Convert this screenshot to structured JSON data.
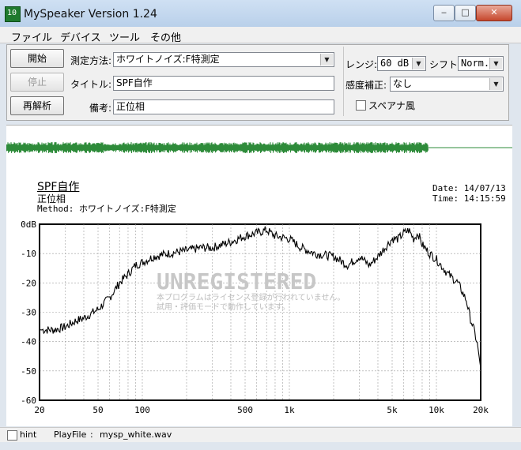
{
  "window": {
    "title": "MySpeaker Version 1.24",
    "icon_text": "10",
    "controls": {
      "minimize": "‒",
      "maximize": "□",
      "close": "✕"
    }
  },
  "menu": [
    "ファイル",
    "デバイス",
    "ツール",
    "その他"
  ],
  "buttons": {
    "start": "開始",
    "stop": "停止",
    "reanalyze": "再解析"
  },
  "fields": {
    "method_label": "測定方法:",
    "method_value": "ホワイトノイズ:F特測定",
    "title_label": "タイトル:",
    "title_value": "SPF自作",
    "note_label": "備考:",
    "note_value": "正位相",
    "range_label": "レンジ:",
    "range_value": "60 dB",
    "shift_label": "シフト:",
    "shift_value": "Norm.",
    "sens_label": "感度補正:",
    "sens_value": "なし",
    "spectrum_label": "スペアナ風"
  },
  "graph": {
    "title": "SPF自作",
    "note": "正位相",
    "method_line": "Method:  ホワイトノイズ:F特測定",
    "date": "Date: 14/07/13",
    "time": "Time: 14:15:59",
    "watermark": "UNREGISTERED",
    "watermark_sub1": "本プログラムはライセンス登録が行われていません。",
    "watermark_sub2": "試用・評価モードで動作しています。"
  },
  "chart_data": {
    "type": "line",
    "xscale": "log",
    "xlim": [
      20,
      20000
    ],
    "ylim": [
      -60,
      0
    ],
    "x_ticks": [
      "20",
      "50",
      "100",
      "500",
      "1k",
      "5k",
      "10k",
      "20k"
    ],
    "y_ticks": [
      "0dB",
      "-10",
      "-20",
      "-30",
      "-40",
      "-50",
      "-60"
    ],
    "grid": true,
    "series": [
      {
        "color": "#000000",
        "x": [
          20,
          25,
          30,
          35,
          40,
          50,
          60,
          70,
          80,
          90,
          100,
          120,
          150,
          200,
          250,
          300,
          400,
          500,
          600,
          700,
          800,
          1000,
          1200,
          1500,
          2000,
          2500,
          3000,
          3500,
          4000,
          5000,
          5500,
          6000,
          6500,
          7000,
          7500,
          8000,
          9000,
          10000,
          12000,
          14000,
          16000,
          17000,
          18000,
          19000,
          20000
        ],
        "y": [
          -36,
          -36,
          -35,
          -33,
          -32,
          -29,
          -25,
          -20,
          -17,
          -14,
          -13,
          -11,
          -10,
          -9,
          -8,
          -8,
          -6,
          -4,
          -3,
          -2,
          -4,
          -5,
          -8,
          -10,
          -11,
          -14,
          -11,
          -14,
          -11,
          -5,
          -5,
          -3,
          -2,
          -5,
          -3,
          -7,
          -10,
          -12,
          -17,
          -20,
          -26,
          -32,
          -36,
          -41,
          -49
        ]
      }
    ]
  },
  "status": {
    "hint_label": "hint",
    "playfile_label": "PlayFile",
    "playfile_sep": ":",
    "playfile_value": "mysp_white.wav"
  }
}
